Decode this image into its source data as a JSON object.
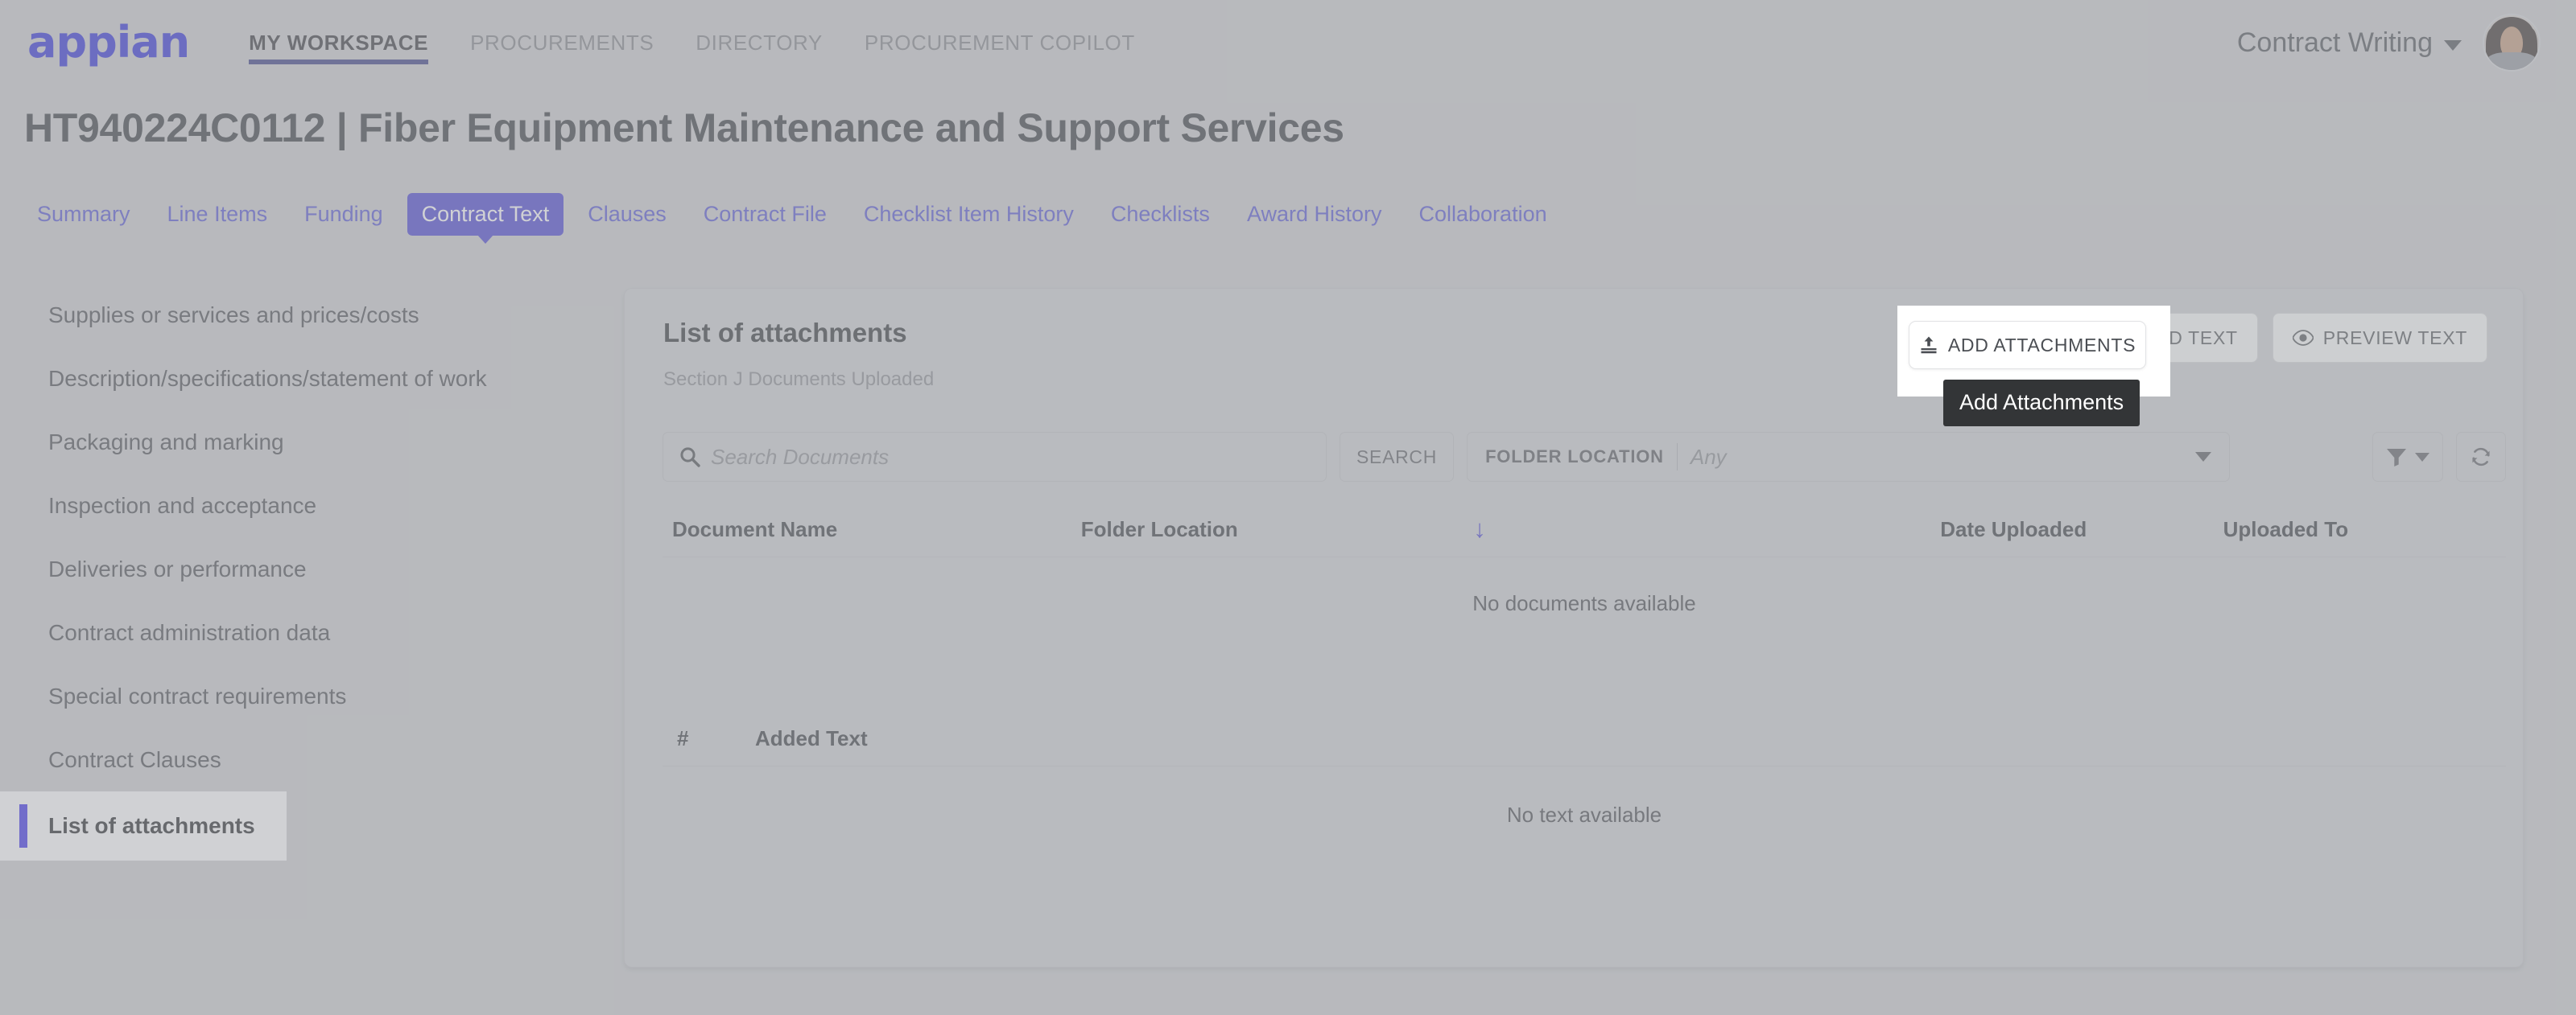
{
  "brand": {
    "logo_text": "appian"
  },
  "topnav": {
    "links": [
      {
        "label": "MY WORKSPACE",
        "active": true
      },
      {
        "label": "PROCUREMENTS",
        "active": false
      },
      {
        "label": "DIRECTORY",
        "active": false
      },
      {
        "label": "PROCUREMENT COPILOT",
        "active": false
      }
    ],
    "user_menu_label": "Contract Writing"
  },
  "page": {
    "title": "HT940224C0112 | Fiber Equipment Maintenance and Support Services"
  },
  "section_tabs": [
    {
      "label": "Summary",
      "active": false
    },
    {
      "label": "Line Items",
      "active": false
    },
    {
      "label": "Funding",
      "active": false
    },
    {
      "label": "Contract Text",
      "active": true
    },
    {
      "label": "Clauses",
      "active": false
    },
    {
      "label": "Contract File",
      "active": false
    },
    {
      "label": "Checklist Item History",
      "active": false
    },
    {
      "label": "Checklists",
      "active": false
    },
    {
      "label": "Award History",
      "active": false
    },
    {
      "label": "Collaboration",
      "active": false
    }
  ],
  "sidebar": {
    "items": [
      {
        "label": "Supplies or services and prices/costs",
        "selected": false
      },
      {
        "label": "Description/specifications/statement of work",
        "selected": false
      },
      {
        "label": "Packaging and marking",
        "selected": false
      },
      {
        "label": "Inspection and acceptance",
        "selected": false
      },
      {
        "label": "Deliveries or performance",
        "selected": false
      },
      {
        "label": "Contract administration data",
        "selected": false
      },
      {
        "label": "Special contract requirements",
        "selected": false
      },
      {
        "label": "Contract Clauses",
        "selected": false
      },
      {
        "label": "List of attachments",
        "selected": true
      }
    ]
  },
  "card": {
    "title": "List of attachments",
    "subtitle": "Section J Documents Uploaded",
    "actions": {
      "add_attachments": "ADD ATTACHMENTS",
      "add_text": "ADD TEXT",
      "preview_text": "PREVIEW TEXT"
    }
  },
  "tooltip": {
    "text": "Add Attachments"
  },
  "search": {
    "placeholder": "Search Documents",
    "value": "",
    "search_button": "SEARCH"
  },
  "folder_filter": {
    "label": "FOLDER LOCATION",
    "value": "Any"
  },
  "documents_table": {
    "columns": [
      "Document Name",
      "Folder Location",
      "",
      "Date Uploaded",
      "Uploaded To"
    ],
    "sort_indicator": "↓",
    "rows": [],
    "empty_message": "No documents available"
  },
  "text_table": {
    "columns": [
      "#",
      "Added Text"
    ],
    "rows": [],
    "empty_message": "No text available"
  },
  "colors": {
    "brand_blue": "#2322d6",
    "accent_blue": "#3c35cf",
    "link_blue": "#4a4ad0",
    "page_bg": "#c9cbcd",
    "card_bg": "#cdcfd1",
    "tooltip_bg": "#333537",
    "selected_accent": "#2f22e8"
  }
}
